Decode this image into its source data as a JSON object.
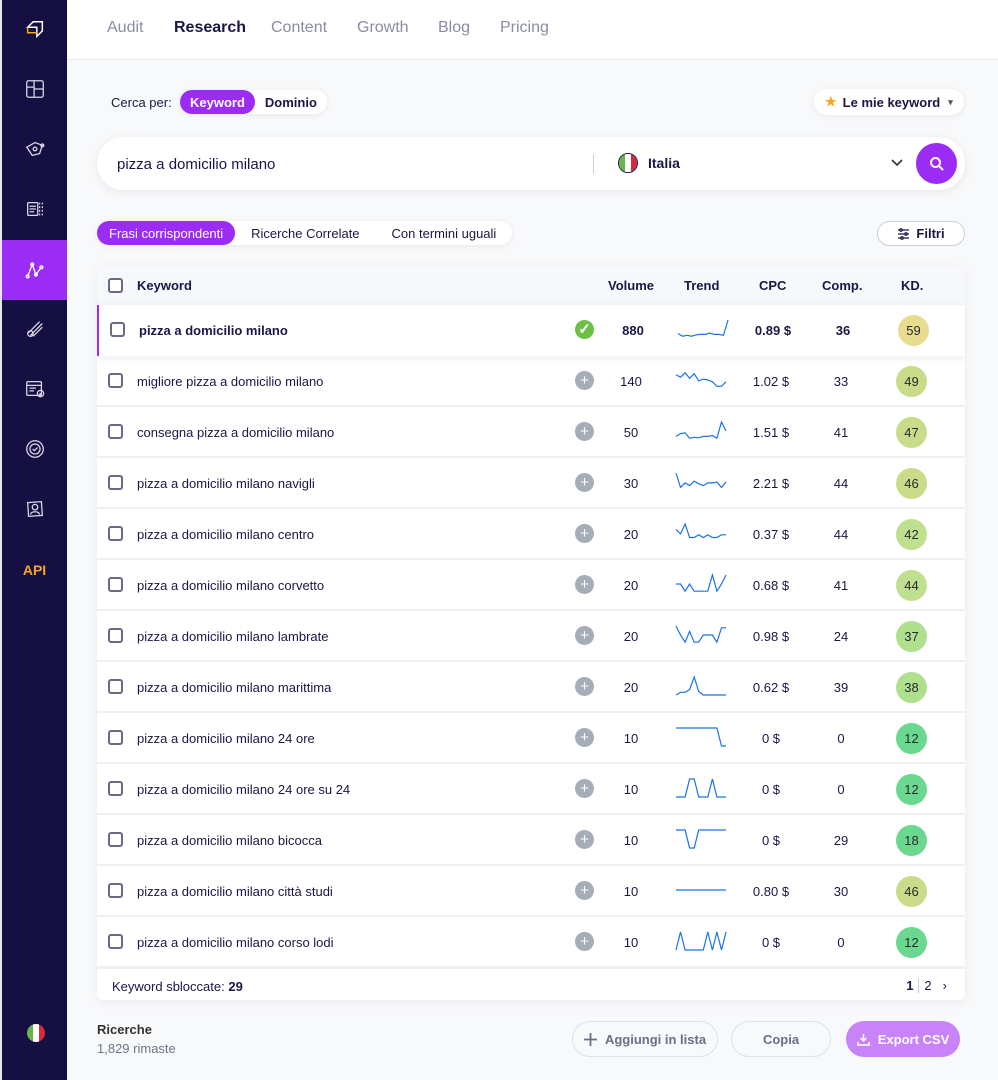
{
  "sidebar": {
    "items": [
      {
        "icon": "logo-icon"
      },
      {
        "icon": "dashboard-icon"
      },
      {
        "icon": "audit-icon"
      },
      {
        "icon": "content-icon"
      },
      {
        "icon": "research-icon",
        "active": true
      },
      {
        "icon": "backlinks-icon"
      },
      {
        "icon": "report-icon"
      },
      {
        "icon": "rank-tracker-icon"
      },
      {
        "icon": "account-icon"
      }
    ],
    "api_label": "API",
    "language_flag": "italy-flag"
  },
  "topnav": {
    "items": [
      "Audit",
      "Research",
      "Content",
      "Growth",
      "Blog",
      "Pricing"
    ],
    "active": "Research"
  },
  "search_by": {
    "label": "Cerca per:",
    "options": [
      "Keyword",
      "Dominio"
    ],
    "active": "Keyword"
  },
  "my_keywords": {
    "label": "Le mie keyword"
  },
  "search": {
    "value": "pizza a domicilio milano",
    "placeholder": "",
    "country": "Italia"
  },
  "tabs": {
    "items": [
      "Frasi corrispondenti",
      "Ricerche Correlate",
      "Con termini uguali"
    ],
    "active": "Frasi corrispondenti"
  },
  "filters_label": "Filtri",
  "table": {
    "columns": {
      "keyword": "Keyword",
      "volume": "Volume",
      "trend": "Trend",
      "cpc": "CPC",
      "comp": "Comp.",
      "kd": "KD."
    },
    "rows": [
      {
        "keyword": "pizza a domicilio milano",
        "added": true,
        "volume": "880",
        "trend": [
          0.25,
          0.1,
          0.15,
          0.1,
          0.18,
          0.2,
          0.2,
          0.28,
          0.2,
          0.2,
          0.15,
          1.0
        ],
        "cpc": "0.89 $",
        "comp": "36",
        "kd": "59",
        "kd_color": "#e8dc8e"
      },
      {
        "keyword": "migliore pizza a domicilio milano",
        "added": false,
        "volume": "140",
        "trend": [
          0.8,
          0.65,
          0.9,
          0.6,
          0.85,
          0.45,
          0.55,
          0.5,
          0.4,
          0.15,
          0.15,
          0.4
        ],
        "cpc": "1.02 $",
        "comp": "33",
        "kd": "49",
        "kd_color": "#c8dc8a"
      },
      {
        "keyword": "consegna pizza a domicilio milano",
        "added": false,
        "volume": "50",
        "trend": [
          0.2,
          0.35,
          0.4,
          0.1,
          0.15,
          0.12,
          0.2,
          0.2,
          0.25,
          0.1,
          1.0,
          0.5
        ],
        "cpc": "1.51 $",
        "comp": "41",
        "kd": "47",
        "kd_color": "#c8dc8a"
      },
      {
        "keyword": "pizza a domicilio milano navigli",
        "added": false,
        "volume": "30",
        "trend": [
          1.0,
          0.2,
          0.45,
          0.3,
          0.55,
          0.4,
          0.3,
          0.45,
          0.45,
          0.5,
          0.2,
          0.5
        ],
        "cpc": "2.21 $",
        "comp": "44",
        "kd": "46",
        "kd_color": "#c8dc8a"
      },
      {
        "keyword": "pizza a domicilio milano centro",
        "added": false,
        "volume": "20",
        "trend": [
          0.7,
          0.45,
          1.0,
          0.25,
          0.25,
          0.4,
          0.25,
          0.4,
          0.25,
          0.25,
          0.4,
          0.4
        ],
        "cpc": "0.37 $",
        "comp": "44",
        "kd": "42",
        "kd_color": "#bfe08e"
      },
      {
        "keyword": "pizza a domicilio milano corvetto",
        "added": false,
        "volume": "20",
        "trend": [
          0.5,
          0.5,
          0.1,
          0.5,
          0.1,
          0.1,
          0.1,
          0.1,
          1.0,
          0.1,
          0.5,
          1.0
        ],
        "cpc": "0.68 $",
        "comp": "41",
        "kd": "44",
        "kd_color": "#bfe08e"
      },
      {
        "keyword": "pizza a domicilio milano lambrate",
        "added": false,
        "volume": "20",
        "trend": [
          1.0,
          0.5,
          0.1,
          0.7,
          0.1,
          0.1,
          0.5,
          0.5,
          0.5,
          0.1,
          0.9,
          0.9
        ],
        "cpc": "0.98 $",
        "comp": "24",
        "kd": "37",
        "kd_color": "#aee08e"
      },
      {
        "keyword": "pizza a domicilio milano marittima",
        "added": false,
        "volume": "20",
        "trend": [
          0.0,
          0.15,
          0.15,
          0.3,
          1.0,
          0.2,
          0.0,
          0.0,
          0.0,
          0.0,
          0.0,
          0.0
        ],
        "cpc": "0.62 $",
        "comp": "39",
        "kd": "38",
        "kd_color": "#aee08e"
      },
      {
        "keyword": "pizza a domicilio milano 24 ore",
        "added": false,
        "volume": "10",
        "trend": [
          1,
          1,
          1,
          1,
          1,
          1,
          1,
          1,
          1,
          1,
          0,
          0
        ],
        "cpc": "0 $",
        "comp": "0",
        "kd": "12",
        "kd_color": "#6ad88e"
      },
      {
        "keyword": "pizza a domicilio milano 24 ore su 24",
        "added": false,
        "volume": "10",
        "trend": [
          0,
          0,
          0,
          1,
          1,
          0,
          0,
          0,
          1,
          0,
          0,
          0
        ],
        "cpc": "0 $",
        "comp": "0",
        "kd": "12",
        "kd_color": "#6ad88e"
      },
      {
        "keyword": "pizza a domicilio milano bicocca",
        "added": false,
        "volume": "10",
        "trend": [
          1,
          1,
          1,
          0,
          0,
          1,
          1,
          1,
          1,
          1,
          1,
          1
        ],
        "cpc": "0 $",
        "comp": "29",
        "kd": "18",
        "kd_color": "#6ad88e"
      },
      {
        "keyword": "pizza a domicilio milano città studi",
        "added": false,
        "volume": "10",
        "trend": [
          0.5,
          0.5,
          0.5,
          0.5,
          0.5,
          0.5,
          0.5,
          0.5,
          0.5,
          0.5,
          0.5,
          0.5
        ],
        "cpc": "0.80 $",
        "comp": "30",
        "kd": "46",
        "kd_color": "#c8dc8a"
      },
      {
        "keyword": "pizza a domicilio milano corso lodi",
        "added": false,
        "volume": "10",
        "trend": [
          0,
          1,
          0,
          0,
          0,
          0,
          0,
          1,
          0,
          1,
          0,
          1
        ],
        "cpc": "0 $",
        "comp": "0",
        "kd": "12",
        "kd_color": "#6ad88e"
      }
    ],
    "footer": {
      "unlocked_label": "Keyword sbloccate:",
      "unlocked_count": "29"
    },
    "pagination": {
      "pages": [
        "1",
        "2"
      ],
      "current": "1"
    }
  },
  "quota": {
    "title": "Ricerche",
    "remaining": "1,829 rimaste"
  },
  "actions": {
    "add_to_list": "Aggiungi in lista",
    "copy": "Copia",
    "export": "Export CSV"
  },
  "colors": {
    "accent": "#9b2cf4",
    "sidebar_bg": "#160f42",
    "trend_line": "#1a73e8",
    "api": "#f5a623",
    "added_check": "#6cc043"
  }
}
